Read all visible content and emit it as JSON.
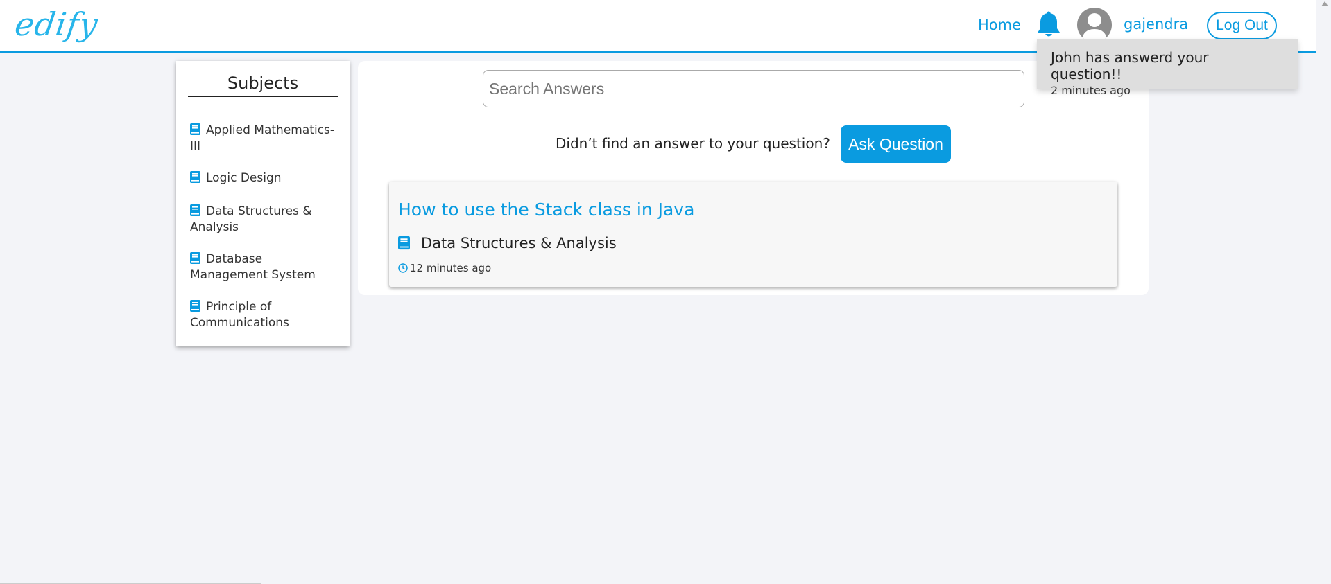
{
  "header": {
    "logo": "edify",
    "home_label": "Home",
    "username": "gajendra",
    "logout_label": "Log Out"
  },
  "notification": {
    "text": "John has answerd your question!!",
    "time": "2 minutes ago"
  },
  "sidebar": {
    "title": "Subjects",
    "items": [
      {
        "label": "Applied Mathematics-III"
      },
      {
        "label": "Logic Design"
      },
      {
        "label": "Data Structures & Analysis"
      },
      {
        "label": "Database Management System"
      },
      {
        "label": "Principle of Communications"
      }
    ]
  },
  "main": {
    "search_placeholder": "Search Answers",
    "ask_prompt": "Didn’t find an answer to your question?",
    "ask_button": "Ask Question",
    "questions": [
      {
        "title": "How to use the Stack class in Java",
        "subject": "Data Structures & Analysis",
        "time": "12 minutes ago"
      }
    ]
  },
  "colors": {
    "accent": "#0a9be0",
    "logo": "#27b5ea",
    "background": "#f3f4f8"
  },
  "icons": {
    "bell": "bell-icon",
    "avatar": "user-avatar-icon",
    "book": "book-icon",
    "clock": "clock-icon"
  }
}
